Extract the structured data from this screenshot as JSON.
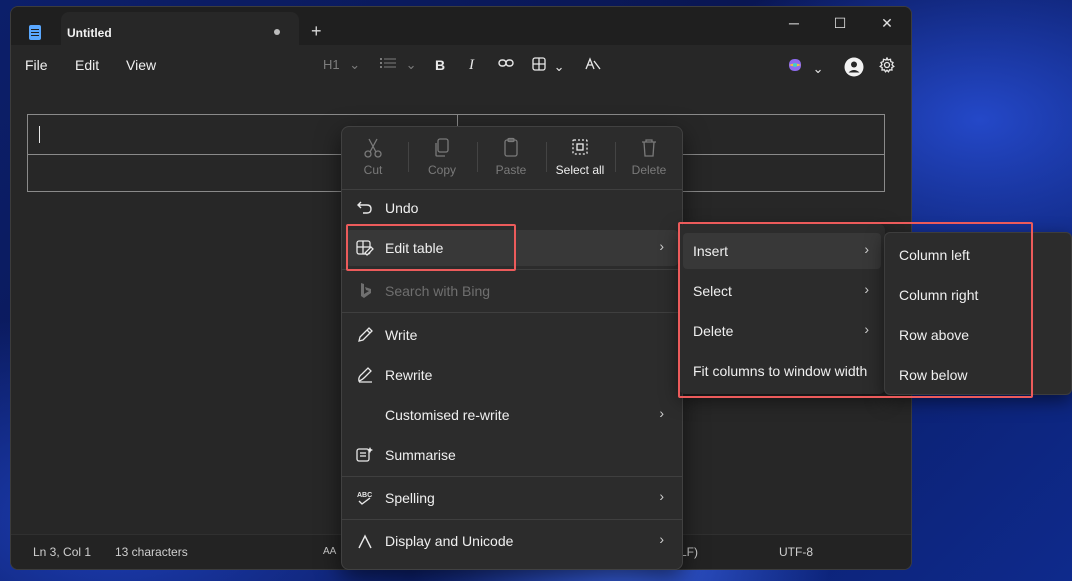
{
  "window": {
    "tab_title": "Untitled",
    "new_tab": "+",
    "controls": {
      "minimize": "─",
      "maximize": "☐",
      "close": "✕"
    }
  },
  "menubar": {
    "file": "File",
    "edit": "Edit",
    "view": "View",
    "heading": "H1",
    "chevron": "⌄",
    "list_icon": "list-icon",
    "bold": "B",
    "italic": "I",
    "link_icon": "link-icon",
    "table_icon": "table-icon",
    "clear_format_icon": "clear-format-icon",
    "copilot_icon": "copilot-icon",
    "account_icon": "account-icon",
    "settings_icon": "gear-icon"
  },
  "context_menu": {
    "quick_actions": [
      {
        "label": "Cut",
        "icon": "scissors-icon",
        "enabled": false
      },
      {
        "label": "Copy",
        "icon": "copy-icon",
        "enabled": false
      },
      {
        "label": "Paste",
        "icon": "paste-icon",
        "enabled": false
      },
      {
        "label": "Select all",
        "icon": "select-all-icon",
        "enabled": true
      },
      {
        "label": "Delete",
        "icon": "trash-icon",
        "enabled": false
      }
    ],
    "items": [
      {
        "label": "Undo",
        "icon": "undo-icon",
        "submenu": false,
        "enabled": true
      },
      {
        "label": "Edit table",
        "icon": "edit-table-icon",
        "submenu": true,
        "enabled": true,
        "active": true
      },
      {
        "label": "Search with Bing",
        "icon": "bing-icon",
        "submenu": false,
        "enabled": false
      },
      {
        "label": "Write",
        "icon": "pen-icon",
        "submenu": false,
        "enabled": true
      },
      {
        "label": "Rewrite",
        "icon": "rewrite-icon",
        "submenu": false,
        "enabled": true
      },
      {
        "label": "Customised re-write",
        "icon": "",
        "submenu": true,
        "enabled": true
      },
      {
        "label": "Summarise",
        "icon": "summarise-icon",
        "submenu": false,
        "enabled": true
      },
      {
        "label": "Spelling",
        "icon": "abc-icon",
        "submenu": true,
        "enabled": true
      },
      {
        "label": "Display and Unicode",
        "icon": "lambda-icon",
        "submenu": true,
        "enabled": true
      }
    ],
    "chevron": "›"
  },
  "edit_table_submenu": [
    {
      "label": "Insert",
      "submenu": true,
      "active": true
    },
    {
      "label": "Select",
      "submenu": true
    },
    {
      "label": "Delete",
      "submenu": true
    },
    {
      "label": "Fit columns to window width",
      "submenu": false
    }
  ],
  "insert_submenu": [
    "Column left",
    "Column right",
    "Row above",
    "Row below"
  ],
  "statusbar": {
    "position": "Ln 3, Col 1",
    "characters": "13 characters",
    "font_icon": "AA",
    "line_ending": "LF)",
    "encoding": "UTF-8"
  },
  "colors": {
    "highlight": "#ec5b5b",
    "accent": "#5aa8ff"
  }
}
